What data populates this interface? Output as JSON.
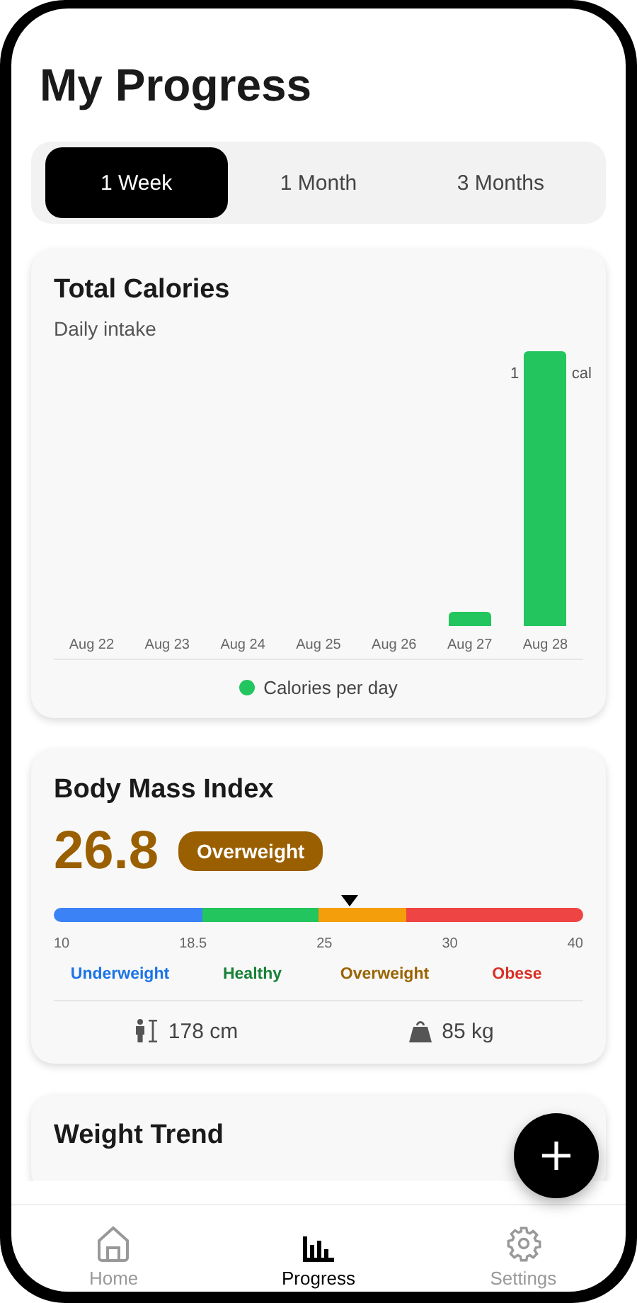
{
  "screen": {
    "title": "My Progress"
  },
  "range_tabs": [
    {
      "label": "1 Week",
      "selected": true
    },
    {
      "label": "1 Month",
      "selected": false
    },
    {
      "label": "3 Months",
      "selected": false
    }
  ],
  "calories_card": {
    "title": "Total Calories",
    "subtitle": "Daily intake",
    "bar_label_parts": [
      "1",
      "cal"
    ],
    "days": [
      "Aug 22",
      "Aug 23",
      "Aug 24",
      "Aug 25",
      "Aug 26",
      "Aug 27",
      "Aug 28"
    ],
    "legend": "Calories per day",
    "color": "#22c55e"
  },
  "bmi_card": {
    "title": "Body Mass Index",
    "value": "26.8",
    "badge": "Overweight",
    "marker": {
      "level": 0.56
    },
    "ticks": [
      "10",
      "18.5",
      "25",
      "30",
      "40"
    ],
    "categories": [
      {
        "label": "Underweight",
        "color": "#1a73e8"
      },
      {
        "label": "Healthy",
        "color": "#188038"
      },
      {
        "label": "Overweight",
        "color": "#9a6400"
      },
      {
        "label": "Obese",
        "color": "#d93025"
      }
    ],
    "height": "178 cm",
    "weight": "85 kg"
  },
  "weight_card": {
    "title": "Weight Trend"
  },
  "nav": [
    {
      "kind": "home",
      "label": "Home",
      "selected": false
    },
    {
      "kind": "progress",
      "label": "Progress",
      "selected": true
    },
    {
      "kind": "settings",
      "label": "Settings",
      "selected": false
    }
  ]
}
